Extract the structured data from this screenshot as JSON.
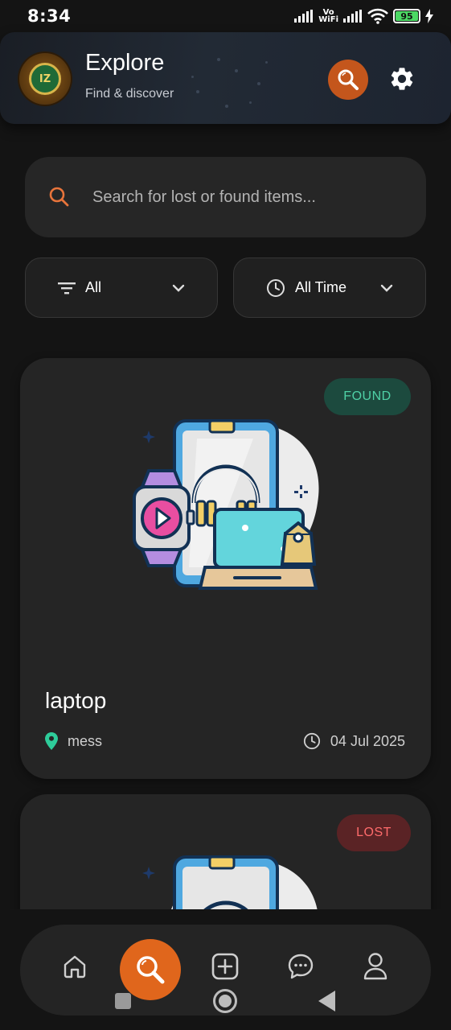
{
  "status": {
    "time": "8:34",
    "vowifi_top": "Vo",
    "vowifi_bottom": "WiFi",
    "battery": "95"
  },
  "header": {
    "avatar_text": "IZ",
    "title": "Explore",
    "subtitle": "Find & discover",
    "search_icon": "search-icon",
    "settings_icon": "gear-icon"
  },
  "search": {
    "placeholder": "Search for lost or found items..."
  },
  "filters": {
    "type_label": "All",
    "time_label": "All Time"
  },
  "items": [
    {
      "status": "FOUND",
      "title": "laptop",
      "location": "mess",
      "date": "04 Jul 2025"
    },
    {
      "status": "LOST"
    }
  ],
  "colors": {
    "accent": "#E0661C",
    "found_bg": "#1C4A3E",
    "found_text": "#4FD1A6",
    "lost_bg": "#5A2325",
    "lost_text": "#FF6B6B",
    "location_pin": "#2ECC9A"
  },
  "nav": {
    "items": [
      "home-icon",
      "search-icon",
      "add-icon",
      "chat-icon",
      "profile-icon"
    ],
    "active": "search-icon"
  }
}
